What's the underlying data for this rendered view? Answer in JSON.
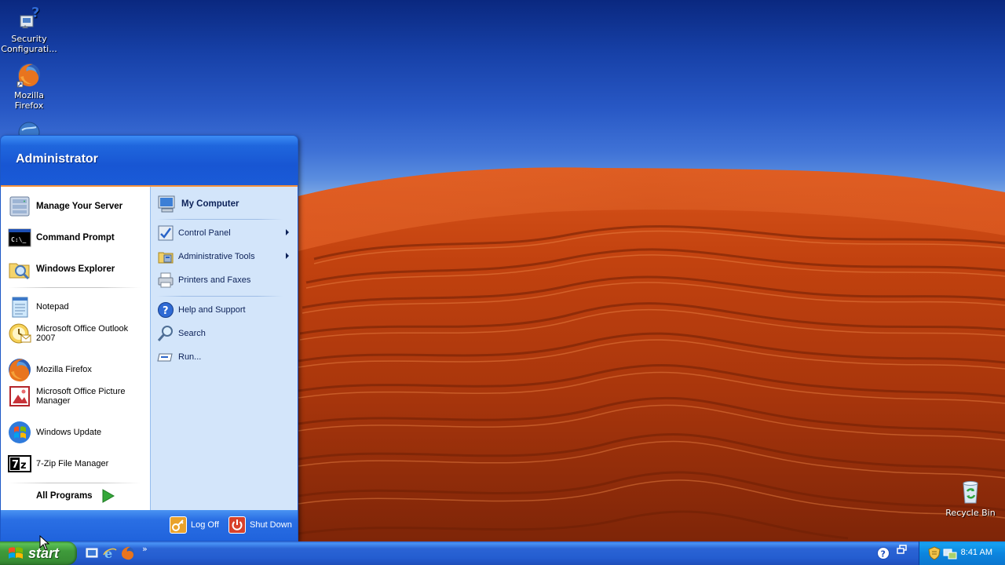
{
  "desktop": {
    "icons": [
      {
        "label": "Security Configurati...",
        "icon": "security-config-icon"
      },
      {
        "label": "Mozilla Firefox",
        "icon": "firefox-icon"
      },
      {
        "label": "Recycle Bin",
        "icon": "recycle-bin-icon"
      }
    ]
  },
  "start_menu": {
    "user": "Administrator",
    "pinned": [
      {
        "label": "Manage Your Server",
        "icon": "manage-server-icon"
      },
      {
        "label": "Command Prompt",
        "icon": "command-prompt-icon"
      },
      {
        "label": "Windows Explorer",
        "icon": "windows-explorer-icon"
      }
    ],
    "recent": [
      {
        "label": "Notepad",
        "icon": "notepad-icon"
      },
      {
        "label": "Microsoft Office Outlook 2007",
        "icon": "outlook-icon"
      },
      {
        "label": "Mozilla Firefox",
        "icon": "firefox-icon"
      },
      {
        "label": "Microsoft Office Picture Manager",
        "icon": "picture-manager-icon"
      },
      {
        "label": "Windows Update",
        "icon": "windows-update-icon"
      },
      {
        "label": "7-Zip File Manager",
        "icon": "7zip-icon"
      }
    ],
    "all_programs": "All Programs",
    "right": [
      {
        "label": "My Computer",
        "icon": "my-computer-icon"
      },
      {
        "label": "Control Panel",
        "icon": "control-panel-icon"
      },
      {
        "label": "Administrative Tools",
        "icon": "admin-tools-icon"
      },
      {
        "label": "Printers and Faxes",
        "icon": "printer-icon"
      },
      {
        "label": "Help and Support",
        "icon": "help-icon"
      },
      {
        "label": "Search",
        "icon": "search-icon"
      },
      {
        "label": "Run...",
        "icon": "run-icon"
      }
    ],
    "log_off": "Log Off",
    "shut_down": "Shut Down"
  },
  "taskbar": {
    "start_label": "start",
    "quick_launch": [
      "show-desktop-icon",
      "internet-explorer-icon",
      "firefox-icon"
    ],
    "overflow": "»",
    "clock": "8:41 AM"
  },
  "colors": {
    "start_green": "#3f9b3b",
    "taskbar_blue": "#245dd0",
    "menu_header": "#1856d3",
    "menu_right": "#d3e5fa",
    "accent_orange": "#f5913c"
  }
}
